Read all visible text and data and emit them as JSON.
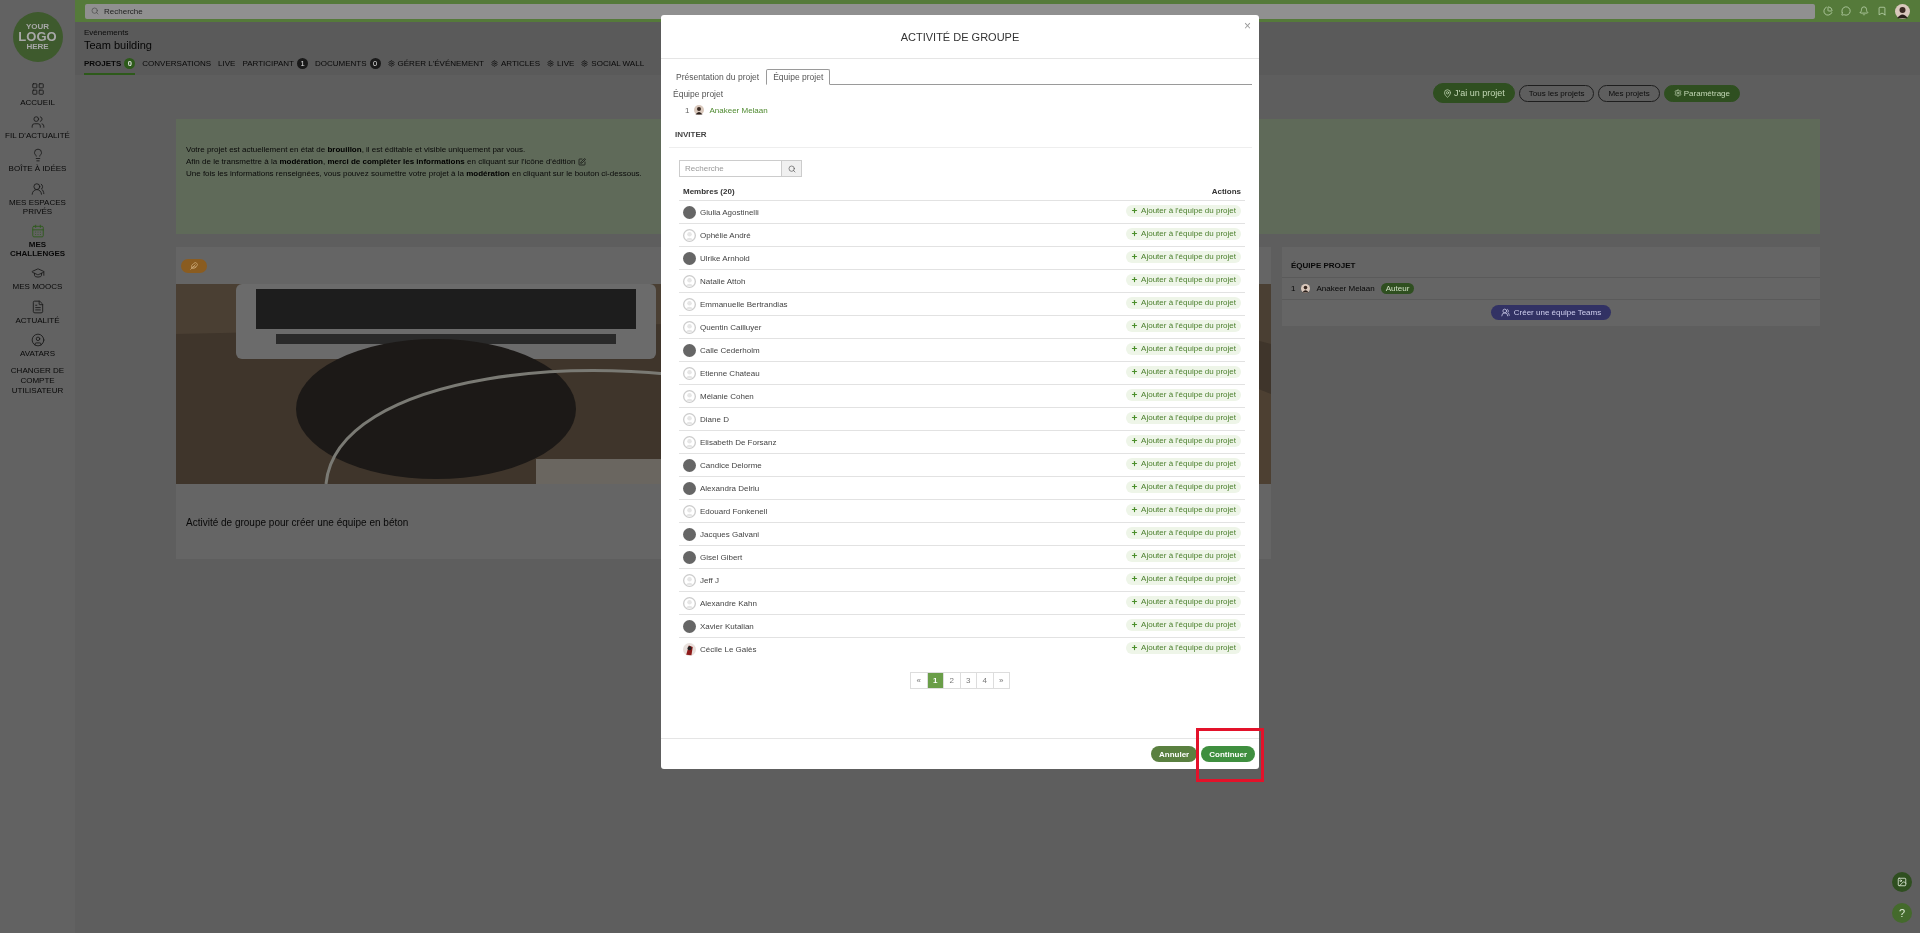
{
  "topbar": {
    "search_placeholder": "Recherche"
  },
  "sidebar": {
    "logo": [
      "YOUR",
      "LOGO",
      "HERE"
    ],
    "items": [
      {
        "label": "ACCUEIL",
        "selected": false
      },
      {
        "label": "FIL D'ACTUALITÉ",
        "selected": false
      },
      {
        "label": "BOÎTE À IDÉES",
        "selected": false
      },
      {
        "label": "MES ESPACES PRIVÉS",
        "selected": false
      },
      {
        "label": "MES CHALLENGES",
        "selected": true
      },
      {
        "label": "MES MOOCS",
        "selected": false
      },
      {
        "label": "ACTUALITÉ",
        "selected": false
      },
      {
        "label": "AVATARS",
        "selected": false
      }
    ],
    "footer": "CHANGER DE COMPTE UTILISATEUR"
  },
  "header": {
    "breadcrumb": "Evénements",
    "title": "Team building",
    "tabs": [
      {
        "label": "PROJETS",
        "kind": "count",
        "badge": "0",
        "selected": true
      },
      {
        "label": "CONVERSATIONS",
        "kind": "text",
        "selected": false
      },
      {
        "label": "LIVE",
        "kind": "text",
        "selected": false
      },
      {
        "label": "PARTICIPANT",
        "kind": "count",
        "badge": "1",
        "selected": false
      },
      {
        "label": "DOCUMENTS",
        "kind": "count",
        "badge": "0",
        "selected": false
      },
      {
        "label": "GÉRER L'ÉVÉNEMENT",
        "kind": "settings",
        "selected": false
      },
      {
        "label": "ARTICLES",
        "kind": "settings",
        "selected": false
      },
      {
        "label": "LIVE",
        "kind": "settings",
        "selected": false
      },
      {
        "label": "SOCIAL WALL",
        "kind": "settings",
        "selected": false
      }
    ]
  },
  "project_buttons": [
    {
      "label": "J'ai un projet",
      "kind": "primary"
    },
    {
      "label": "Tous les projets",
      "kind": "outline"
    },
    {
      "label": "Mes projets",
      "kind": "outline"
    },
    {
      "label": "Paramétrage",
      "kind": "settings"
    }
  ],
  "notice": [
    "Votre projet est actuellement en état de **brouillon**, il est éditable et visible uniquement par vous.",
    "Afin de le transmettre à la **modération**, **merci de compléter les informations** en cliquant sur l'icône d'édition",
    "Une fois les informations renseignées, vous pouvez soumettre votre projet à la **modération** en cliquant sur le bouton ci-dessous."
  ],
  "project_card": {
    "title": "Activité de groupe pour créer une équipe en béton"
  },
  "team_card": {
    "title": "ÉQUIPE PROJET",
    "members": [
      {
        "index": "1",
        "name": "Anakeer Melaan",
        "role": "Auteur"
      }
    ],
    "button": "Créer une équipe Teams"
  },
  "modal": {
    "title": "ACTIVITÉ DE GROUPE",
    "close": "×",
    "tabs": [
      {
        "label": "Présentation du projet",
        "selected": false
      },
      {
        "label": "Équipe projet",
        "selected": true
      }
    ],
    "team_heading": "Équipe projet",
    "team": [
      {
        "index": "1",
        "name": "Anakeer Melaan"
      }
    ],
    "invite_heading": "INVITER",
    "search_placeholder": "Recherche",
    "members_header": "Membres (20)",
    "actions_header": "Actions",
    "members": [
      {
        "name": "Giulia Agostinelli",
        "kind": "filled",
        "action": "Ajouter à l'équipe du projet"
      },
      {
        "name": "Ophélie André",
        "kind": "empty",
        "action": "Ajouter à l'équipe du projet"
      },
      {
        "name": "Ulrike Arnhold",
        "kind": "filled",
        "action": "Ajouter à l'équipe du projet"
      },
      {
        "name": "Natalie Attoh",
        "kind": "empty",
        "action": "Ajouter à l'équipe du projet"
      },
      {
        "name": "Emmanuelle Bertrandias",
        "kind": "empty",
        "action": "Ajouter à l'équipe du projet"
      },
      {
        "name": "Quentin Cailluyer",
        "kind": "empty",
        "action": "Ajouter à l'équipe du projet"
      },
      {
        "name": "Calle Cederholm",
        "kind": "filled",
        "action": "Ajouter à l'équipe du projet"
      },
      {
        "name": "Etienne Chateau",
        "kind": "empty",
        "action": "Ajouter à l'équipe du projet"
      },
      {
        "name": "Mélanie Cohen",
        "kind": "empty",
        "action": "Ajouter à l'équipe du projet"
      },
      {
        "name": "Diane D",
        "kind": "empty",
        "action": "Ajouter à l'équipe du projet"
      },
      {
        "name": "Elisabeth De Forsanz",
        "kind": "empty",
        "action": "Ajouter à l'équipe du projet"
      },
      {
        "name": "Candice Delorme",
        "kind": "filled",
        "action": "Ajouter à l'équipe du projet"
      },
      {
        "name": "Alexandra Delriu",
        "kind": "filled",
        "action": "Ajouter à l'équipe du projet"
      },
      {
        "name": "Edouard Fonkenell",
        "kind": "empty",
        "action": "Ajouter à l'équipe du projet"
      },
      {
        "name": "Jacques Galvani",
        "kind": "filled",
        "action": "Ajouter à l'équipe du projet"
      },
      {
        "name": "Gisel Gibert",
        "kind": "filled",
        "action": "Ajouter à l'équipe du projet"
      },
      {
        "name": "Jeff J",
        "kind": "empty",
        "action": "Ajouter à l'équipe du projet"
      },
      {
        "name": "Alexandre Kahn",
        "kind": "empty",
        "action": "Ajouter à l'équipe du projet"
      },
      {
        "name": "Xavier Kutalian",
        "kind": "filled",
        "action": "Ajouter à l'équipe du projet"
      },
      {
        "name": "Cécile Le Galès",
        "action": "Ajouter à l'équipe du projet"
      }
    ],
    "pagination": {
      "prev": "«",
      "next": "»",
      "pages": [
        {
          "label": "1",
          "selected": true
        },
        {
          "label": "2",
          "selected": false
        },
        {
          "label": "3",
          "selected": false
        },
        {
          "label": "4",
          "selected": false
        }
      ]
    },
    "buttons": [
      {
        "label": "Annuler",
        "kind": "secondary",
        "highlighted": false
      },
      {
        "label": "Continuer",
        "kind": "primary",
        "highlighted": true
      }
    ]
  },
  "help_button": "?"
}
